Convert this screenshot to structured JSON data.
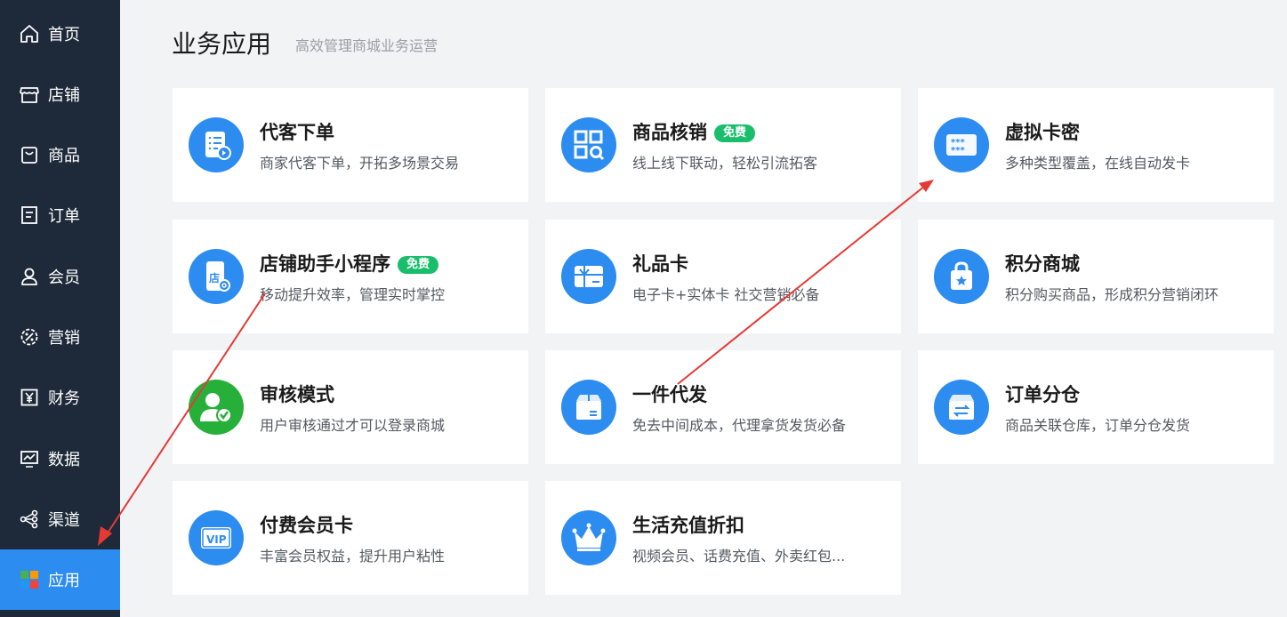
{
  "sidebar": {
    "items": [
      {
        "label": "首页",
        "icon": "home-icon"
      },
      {
        "label": "店铺",
        "icon": "store-icon"
      },
      {
        "label": "商品",
        "icon": "bag-icon"
      },
      {
        "label": "订单",
        "icon": "order-icon"
      },
      {
        "label": "会员",
        "icon": "user-icon"
      },
      {
        "label": "营销",
        "icon": "marketing-icon"
      },
      {
        "label": "财务",
        "icon": "finance-icon"
      },
      {
        "label": "数据",
        "icon": "data-icon"
      },
      {
        "label": "渠道",
        "icon": "channel-icon"
      },
      {
        "label": "应用",
        "icon": "apps-icon",
        "active": true
      }
    ]
  },
  "header": {
    "title": "业务应用",
    "subtitle": "高效管理商城业务运营"
  },
  "cards": [
    {
      "title": "代客下单",
      "desc": "商家代客下单，开拓多场景交易",
      "icon": "order-list-icon"
    },
    {
      "title": "商品核销",
      "badge": "免费",
      "desc": "线上线下联动，轻松引流拓客",
      "icon": "qr-scan-icon"
    },
    {
      "title": "虚拟卡密",
      "desc": "多种类型覆盖，在线自动发卡",
      "icon": "card-password-icon"
    },
    {
      "title": "店铺助手小程序",
      "badge": "免费",
      "desc": "移动提升效率，管理实时掌控",
      "icon": "mini-program-icon"
    },
    {
      "title": "礼品卡",
      "desc": "电子卡+实体卡 社交营销必备",
      "icon": "gift-card-icon"
    },
    {
      "title": "积分商城",
      "desc": "积分购买商品，形成积分营销闭环",
      "icon": "points-bag-icon"
    },
    {
      "title": "审核模式",
      "desc": "用户审核通过才可以登录商城",
      "icon": "user-check-icon"
    },
    {
      "title": "一件代发",
      "desc": "免去中间成本，代理拿货发货必备",
      "icon": "package-icon"
    },
    {
      "title": "订单分仓",
      "desc": "商品关联仓库，订单分仓发货",
      "icon": "warehouse-icon"
    },
    {
      "title": "付费会员卡",
      "desc": "丰富会员权益，提升用户粘性",
      "icon": "vip-card-icon"
    },
    {
      "title": "生活充值折扣",
      "desc": "视频会员、话费充值、外卖红包...",
      "icon": "crown-icon"
    }
  ],
  "vip_text": "VIP",
  "store_char": "店",
  "colors": {
    "sidebar_bg": "#1e2a3a",
    "active": "#2d8cf0",
    "badge": "#19be6b",
    "arrow": "#e53935"
  }
}
